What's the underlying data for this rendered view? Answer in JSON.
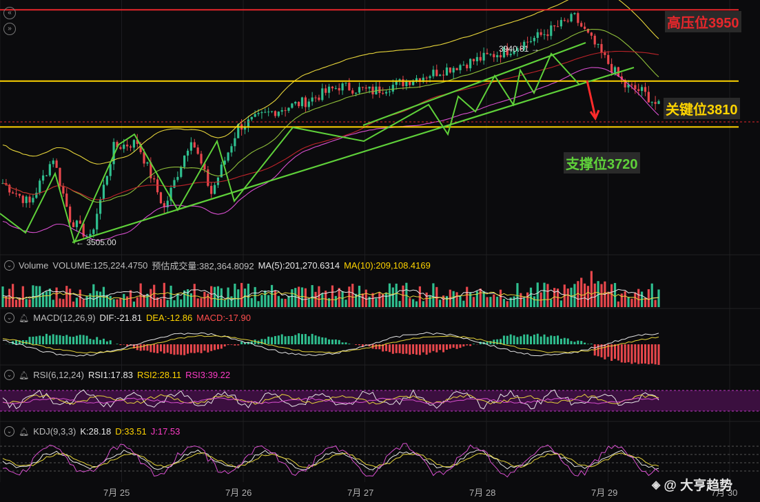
{
  "chart_data": {
    "type": "candlestick",
    "series_count": 90,
    "ylim": [
      3480,
      3980
    ],
    "levels": [
      {
        "name": "高压位3950",
        "value": 3950,
        "color": "#e8262b"
      },
      {
        "name": "关键位3810",
        "value": 3810,
        "color": "#ffd400"
      },
      {
        "name": "支撑位3720",
        "value": 3720,
        "color": "#ffd400"
      }
    ],
    "annotations": {
      "high_label": "3940.81 →",
      "low_label": "← 3505.00"
    },
    "x_ticks": [
      "7月 25",
      "7月 26",
      "7月 27",
      "7月 28",
      "7月 29",
      "7月 30"
    ]
  },
  "labels": {
    "resistance": "高压位3950",
    "key": "关键位3810",
    "support": "支撑位3720"
  },
  "indicators": {
    "volume": {
      "name": "Volume",
      "vol": "VOLUME:125,224.4750",
      "est": "预估成交量:382,364.8092",
      "ma5": "MA(5):201,270.6314",
      "ma10": "MA(10):209,108.4169"
    },
    "macd": {
      "name": "MACD(12,26,9)",
      "dif": "DIF:-21.81",
      "dea": "DEA:-12.86",
      "macd": "MACD:-17.90"
    },
    "rsi": {
      "name": "RSI(6,12,24)",
      "rsi1": "RSI1:17.83",
      "rsi2": "RSI2:28.11",
      "rsi3": "RSI3:39.22"
    },
    "kdj": {
      "name": "KDJ(9,3,3)",
      "k": "K:28.18",
      "d": "D:33.51",
      "j": "J:17.53"
    }
  },
  "watermark": "@ 大亨趋势",
  "colors": {
    "up": "#2fbf8f",
    "down": "#e8474c",
    "bg": "#0b0b0d"
  }
}
